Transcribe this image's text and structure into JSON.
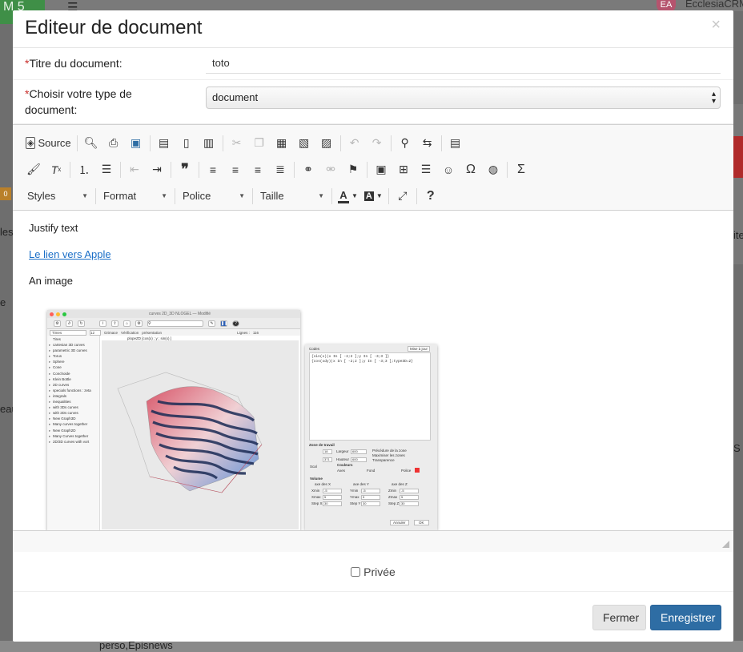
{
  "background": {
    "app_badge": "M 5",
    "user_initials": "EA",
    "user_name": "EcclesiaCRM",
    "left_fragments": [
      "les",
      "e",
      "eau"
    ],
    "right_fragments": [
      "ite",
      "S"
    ],
    "bottom_fragments": [
      "perso,Episnews"
    ],
    "badge_count": "0"
  },
  "modal": {
    "title": "Editeur de document",
    "close_label": "×",
    "title_field": {
      "required_mark": "*",
      "label": "Titre du document:",
      "value": "toto"
    },
    "type_field": {
      "required_mark": "*",
      "label": "Choisir votre type de document:",
      "selected": "document"
    },
    "private_label": "Privée",
    "close_button": "Fermer",
    "save_button": "Enregistrer"
  },
  "editor": {
    "toolbar": {
      "source_label": "Source",
      "combos": [
        "Styles",
        "Format",
        "Police",
        "Taille"
      ],
      "text_color_label": "A",
      "bg_color_label": "A"
    },
    "content": {
      "line1": "Justify text",
      "link_text": "Le lien vers Apple",
      "line3": "An image"
    }
  },
  "embedded_screenshot": {
    "window_title": "curves 2D_3D NLOGEL — Modifié",
    "font_name": "Times",
    "font_size": "12",
    "toolbar_checks": [
      "Grimace",
      "Vérification",
      "présentation"
    ],
    "lines_label": "Lignes :",
    "lines_value": "116",
    "expression_header": "plopeZD  [cos(x) ; y ; sin(x) ]",
    "sidebar_items": [
      "Tires",
      "cartesian 3D curves",
      "parametric 3D curves",
      "Torus",
      "Sphere",
      "Cone",
      "Conchoide",
      "Klein Bottle",
      "2D curves",
      "specials functions : zeta",
      "integrals",
      "inequalities",
      "with 3Ds curves",
      "with 2Ds curves",
      "New Graph3D",
      "Many curves together",
      "New Graph2D",
      "Many Curves together",
      "2D/3D curves with vort"
    ],
    "side_panel": {
      "codes_label": "Codes",
      "update_button": "Mise à jour",
      "code_lines": [
        "{sin(x)|x In [ -2;2 ];y In [ -3;3 ]}",
        "{cos(xdy)|x In [ -2;2 ];y In [ -3;3 ];type3D=2}"
      ],
      "zone_label": "Zone de travail",
      "largeur": "Largeur",
      "hauteur": "Hauteur",
      "checks": [
        "Précédure de la zone",
        "Maximiser les zones",
        "Transparence"
      ],
      "couleurs_label": "Couleurs",
      "axes_label": "Axes",
      "fond_label": "Fond",
      "police_label": "Police",
      "scal_label": "Scal",
      "volume_label": "Volume",
      "axis_groups": [
        "axe des X",
        "axe des Y",
        "axe des Z"
      ],
      "field_labels": [
        "Xmin",
        "Xmax",
        "Step X",
        "Ymin",
        "Ymax",
        "Step Y",
        "Zmin",
        "Zmax",
        "Step Z"
      ],
      "cancel_button": "Annuler",
      "ok_button": "OK"
    }
  },
  "colors": {
    "primary": "#2e6da4",
    "link": "#1a6ec7",
    "required": "#c9302c"
  }
}
